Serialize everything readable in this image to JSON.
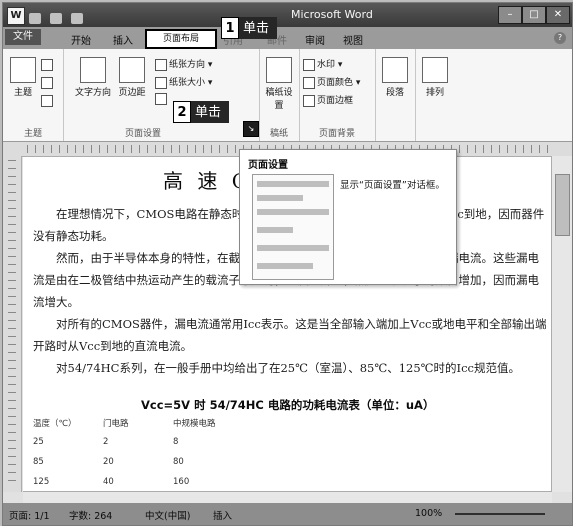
{
  "window": {
    "title": "Microsoft Word",
    "app_icon": "W"
  },
  "tabs": [
    "文件",
    "开始",
    "插入",
    "页面布局",
    "引用",
    "邮件",
    "审阅",
    "视图"
  ],
  "ribbon": {
    "groups": [
      "主题",
      "页面设置",
      "稿纸",
      "页面背景",
      "段落",
      "排列"
    ],
    "theme_btn": "主题",
    "text_dir": "文字方向",
    "margins": "页边距",
    "orientation": "纸张方向",
    "size": "纸张大小",
    "draft_btn": "稿纸设置",
    "watermark": "水印",
    "page_color": "页面颜色",
    "page_border": "页面边框",
    "paragraph_btn": "段落",
    "arrange_btn": "排列"
  },
  "callouts": [
    {
      "num": "1",
      "text": "单击"
    },
    {
      "num": "2",
      "text": "单击"
    }
  ],
  "popup": {
    "title": "页面设置",
    "desc": "显示“页面设置”对话框。"
  },
  "doc": {
    "title": "高 速 CMOS",
    "paragraphs": [
      "在理想情况下，CMOS电路在静态时，VDD到地之间总有一个管子截止，从Vcc到地，因而器件没有静态功耗。",
      "然而，由于半导体本身的特性，在截止管子的漏极、源极之间仍存在着微小的漏电流。这些漏电流是由在二极管结中热运动产生的载流子形成的，温度上升时，热产生载流子的数目增加，因而漏电流增大。",
      "对所有的CMOS器件，漏电流通常用Icc表示。这是当全部输入端加上Vcc或地电平和全部输出端开路时从Vcc到地的直流电流。",
      "对54/74HC系列，在一般手册中均给出了在25℃（室温）、85℃、125℃时的Icc规范值。"
    ],
    "table_title": "Vcc=5V 时 54/74HC 电路的功耗电流表（单位：uA）",
    "table": {
      "headers": [
        "温度（℃）",
        "门电路",
        "中规模电路"
      ],
      "rows": [
        [
          "25",
          "2",
          "8"
        ],
        [
          "85",
          "20",
          "80"
        ],
        [
          "125",
          "40",
          "160"
        ]
      ]
    }
  },
  "status": {
    "page": "页面: 1/1",
    "words": "字数: 264",
    "lang": "中文(中国)",
    "mode": "插入",
    "zoom": "100%"
  }
}
